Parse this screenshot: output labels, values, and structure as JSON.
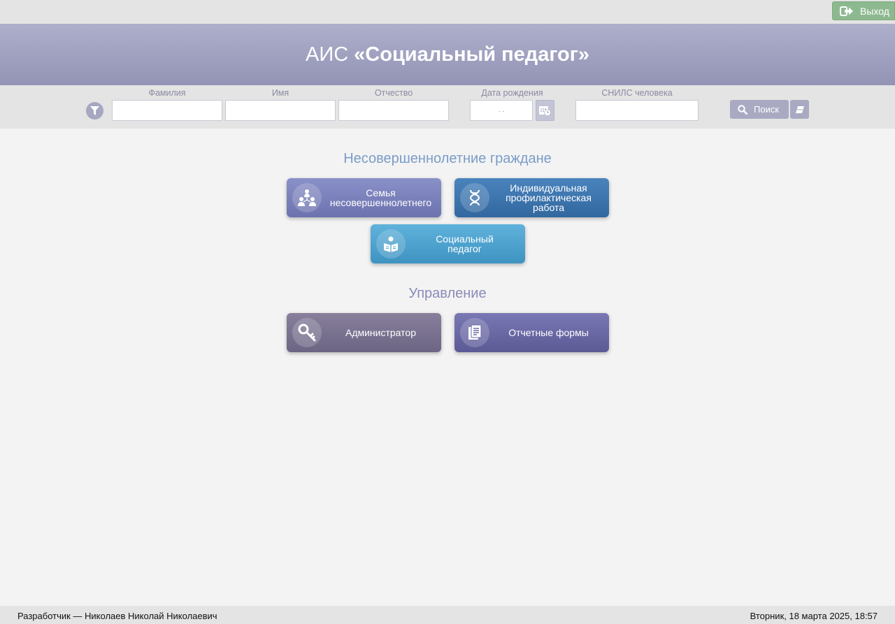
{
  "topbar": {
    "logout_label": "Выход"
  },
  "header": {
    "prefix": "АИС",
    "title": "«Социальный педагог»"
  },
  "search": {
    "fields": [
      {
        "label": "Фамилия",
        "value": ""
      },
      {
        "label": "Имя",
        "value": ""
      },
      {
        "label": "Отчество",
        "value": ""
      },
      {
        "label": "Дата рождения",
        "value": ". ."
      },
      {
        "label": "СНИЛС человека",
        "value": ""
      }
    ],
    "search_label": "Поиск"
  },
  "sections": {
    "minors": {
      "title": "Несовершеннолетние граждане",
      "title_color": "#7a9cc7",
      "tiles": [
        {
          "label": "Семья\nнесовершеннолетнего",
          "icon": "family-icon",
          "color": "#7f86c0"
        },
        {
          "label": "Индивидуальная\nпрофилактическая\nработа",
          "icon": "dna-icon",
          "color": "#3f78b0"
        },
        {
          "label": "Социальный\nпедагог",
          "icon": "reader-icon",
          "color": "#4aa3cf"
        }
      ]
    },
    "management": {
      "title": "Управление",
      "title_color": "#8a8bb8",
      "tiles": [
        {
          "label": "Администратор",
          "icon": "key-icon",
          "color": "#7d7593"
        },
        {
          "label": "Отчетные формы",
          "icon": "document-icon",
          "color": "#6c6aa5"
        }
      ]
    }
  },
  "footer": {
    "developer": "Разработчик — Николаев Николай Николаевич",
    "datetime": "Вторник, 18 марта 2025, 18:57"
  }
}
